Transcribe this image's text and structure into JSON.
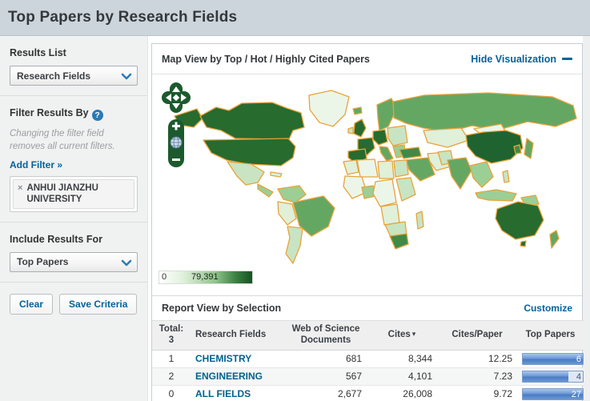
{
  "page": {
    "title": "Top Papers by Research Fields"
  },
  "sidebar": {
    "results_list": {
      "label": "Results List",
      "value": "Research Fields"
    },
    "filter": {
      "label": "Filter Results By",
      "help_icon": "?",
      "note": "Changing the filter field removes all current filters.",
      "add_filter_label": "Add Filter »",
      "tags": [
        {
          "remove_icon": "×",
          "label": "ANHUI JIANZHU UNIVERSITY"
        }
      ]
    },
    "include": {
      "label": "Include Results For",
      "value": "Top Papers"
    },
    "buttons": {
      "clear": "Clear",
      "save": "Save Criteria"
    }
  },
  "map_section": {
    "title": "Map View by Top / Hot / Highly Cited Papers",
    "hide_link": "Hide Visualization",
    "legend": {
      "min": "0",
      "max": "79,391"
    },
    "palette": {
      "dark": "#276b2f",
      "darker": "#1f6430",
      "medium": "#64a763",
      "mediumdark": "#3f8a48",
      "lightmed": "#9ccf95",
      "light": "#c9e4c2",
      "pale": "#e0f0d9",
      "palest": "#ecf6e8",
      "border": "#e8a33b"
    }
  },
  "report_section": {
    "title": "Report View by Selection",
    "customize_link": "Customize",
    "table": {
      "total_label": "Total:",
      "total_count": "3",
      "columns": {
        "field": "Research Fields",
        "docs_line1": "Web of Science",
        "docs_line2": "Documents",
        "cites": "Cites",
        "sort_icon": "▾",
        "cites_per_paper": "Cites/Paper",
        "top_papers": "Top Papers"
      },
      "rows": [
        {
          "rank": "1",
          "field": "CHEMISTRY",
          "documents": "681",
          "cites": "8,344",
          "cites_per_paper": "12.25",
          "top_papers": "6",
          "bar_pct": 100,
          "bar_text_color": "#ffffff"
        },
        {
          "rank": "2",
          "field": "ENGINEERING",
          "documents": "567",
          "cites": "4,101",
          "cites_per_paper": "7.23",
          "top_papers": "4",
          "bar_pct": 76,
          "bar_text_color": "#44566e"
        },
        {
          "rank": "0",
          "field": "ALL FIELDS",
          "documents": "2,677",
          "cites": "26,008",
          "cites_per_paper": "9.72",
          "top_papers": "27",
          "bar_pct": 100,
          "bar_text_color": "#ffffff"
        }
      ]
    }
  }
}
